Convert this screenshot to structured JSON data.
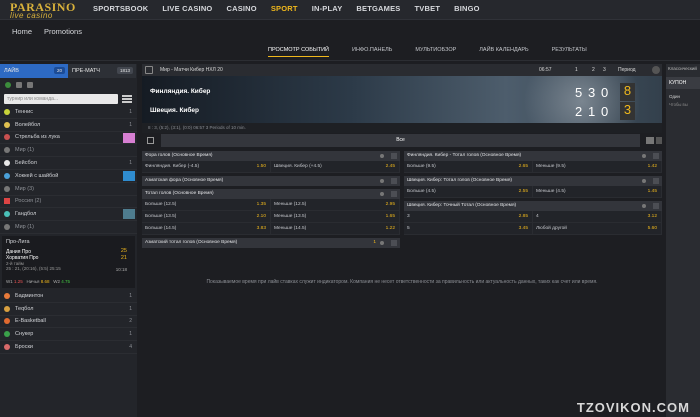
{
  "brand": {
    "name": "PARASINO",
    "sub": "live casino"
  },
  "nav": [
    "SPORTSBOOK",
    "LIVE CASINO",
    "CASINO",
    "SPORT",
    "IN-PLAY",
    "BETGAMES",
    "TVBET",
    "BINGO"
  ],
  "nav_active": "SPORT",
  "subnav": [
    "Home",
    "Promotions"
  ],
  "tabs": [
    "ПРОСМОТР СОБЫТИЙ",
    "ИНФО.ПАНЕЛЬ",
    "МУЛЬТИОБЗОР",
    "ЛАЙВ КАЛЕНДАРЬ",
    "РЕЗУЛЬТАТЫ"
  ],
  "sidebar": {
    "live_label": "ЛАЙВ",
    "live_count": "20",
    "pre_label": "ПРЕ-МАТЧ",
    "pre_count": "1813",
    "search_placeholder": "турнир или команда...",
    "sports": [
      {
        "label": "Теннис",
        "count": "1"
      },
      {
        "label": "Волейбол",
        "count": "1"
      },
      {
        "label": "Стрельба из лука",
        "count": ""
      },
      {
        "label": "Мир (1)",
        "count": "",
        "sub": true
      },
      {
        "label": "Бейсбол",
        "count": "1"
      },
      {
        "label": "Хоккей с шайбой",
        "count": ""
      },
      {
        "label": "Мир (3)",
        "count": "",
        "sub": true
      },
      {
        "label": "Россия (2)",
        "count": "",
        "sub": true
      },
      {
        "label": "Гандбол",
        "count": ""
      },
      {
        "label": "Мир (1)",
        "count": "",
        "sub": true
      }
    ],
    "match": {
      "league": "Про-Лига",
      "team1": "Дания Про",
      "team2": "Хорватия Про",
      "score1": "25",
      "score2": "21",
      "half": "2-й тайм",
      "meta": "25 : 21, (20:16), (5:5) 25:15",
      "time": "10:18",
      "w1": "W1",
      "w1_odd": "1.25",
      "x_label": "Ничья",
      "x_odd": "8.68",
      "w2": "W2",
      "w2_odd": "4.75"
    },
    "sports_bottom": [
      {
        "label": "Бадминтон",
        "count": "1"
      },
      {
        "label": "Теqбол",
        "count": "1"
      },
      {
        "label": "E-Basketball",
        "count": "2"
      },
      {
        "label": "Снукер",
        "count": "1"
      },
      {
        "label": "Броски",
        "count": "4"
      }
    ]
  },
  "event": {
    "title": "Мир - Матчи Кибер НХЛ 20",
    "time": "06:57",
    "p1": "1",
    "p2": "2",
    "p3": "3",
    "period": "Период",
    "team1": "Финляндия. Кибер",
    "team2": "Швеция. Кибер",
    "t1_scores": [
      "5",
      "3",
      "0"
    ],
    "t1_total": "8",
    "t2_scores": [
      "2",
      "1",
      "0"
    ],
    "t2_total": "3",
    "info": "8 : 3, (5:2), (3:1), (0:0) 06:57 3 Periods of 10 min.",
    "filter_all": "Все"
  },
  "markets_left": [
    {
      "title": "Фора голов (Основное Время)",
      "rows": [
        [
          {
            "l": "Финляндия. Кибер (-4.5)",
            "o": "1.50"
          },
          {
            "l": "Швеция. Кибер (+4.5)",
            "o": "2.45"
          }
        ]
      ]
    },
    {
      "title": "Азиатская фора (Основное Время)",
      "rows": []
    },
    {
      "title": "Тотал голов (Основное Время)",
      "rows": [
        [
          {
            "l": "Больше (12.5)",
            "o": "1.35"
          },
          {
            "l": "Меньше (12.5)",
            "o": "2.95"
          }
        ],
        [
          {
            "l": "Больше (13.5)",
            "o": "2.10"
          },
          {
            "l": "Меньше (13.5)",
            "o": "1.65"
          }
        ],
        [
          {
            "l": "Больше (14.5)",
            "o": "3.83"
          },
          {
            "l": "Меньше (14.5)",
            "o": "1.22"
          }
        ]
      ]
    },
    {
      "title": "Азиатский тотал голов (Основное Время)",
      "rows": []
    }
  ],
  "markets_right": [
    {
      "title": "Финляндия. Кибер - Тотал голов (Основное Время)",
      "rows": [
        [
          {
            "l": "Больше (9.5)",
            "o": "2.65"
          },
          {
            "l": "Меньше (9.5)",
            "o": "1.42"
          }
        ]
      ]
    },
    {
      "title": "Швеция. Кибер: Тотал голов (Основное Время)",
      "rows": [
        [
          {
            "l": "Больше (4.5)",
            "o": "2.55"
          },
          {
            "l": "Меньше (4.5)",
            "o": "1.45"
          }
        ]
      ]
    },
    {
      "title": "Швеция. Кибер: Точный Тотал (Основное Время)",
      "rows": [
        [
          {
            "l": "3",
            "o": "2.85"
          },
          {
            "l": "4",
            "o": "3.12"
          }
        ],
        [
          {
            "l": "5",
            "o": "3.45"
          },
          {
            "l": "Любой другой",
            "o": "5.60"
          }
        ]
      ]
    }
  ],
  "asian_total_count": "1",
  "disclaimer": "Показываемое время при лайв ставках служит индикатором. Компания не несет ответственности за правильность или актуальность данных, таких как счет или время.",
  "right_panel": {
    "header": "Классический",
    "button": "КУПОН",
    "sub": "Один",
    "note": "Чтобы вы"
  },
  "watermark": "TZOVIKON.COM"
}
